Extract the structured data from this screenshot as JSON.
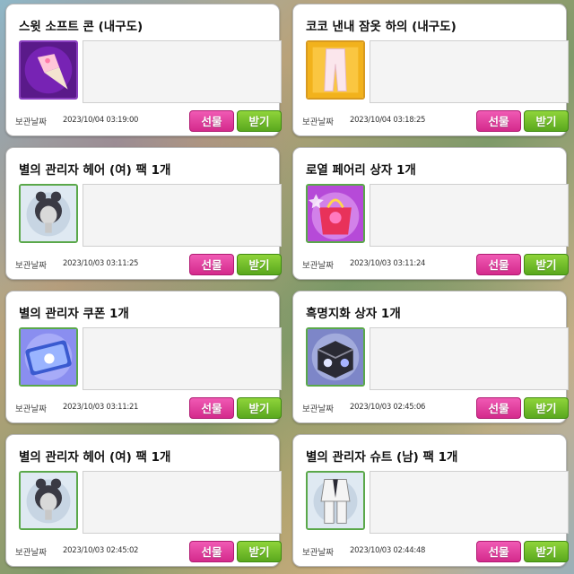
{
  "labels": {
    "date_label": "보관날짜",
    "gift_button": "선물",
    "receive_button": "받기"
  },
  "items": [
    {
      "name": "스윗 소프트 콘 (내구도)",
      "date": "2023/10/04 03:19:00",
      "icon": "soft-cone-icon"
    },
    {
      "name": "코코 낸내 잠옷 하의 (내구도)",
      "date": "2023/10/04 03:18:25",
      "icon": "pajama-pants-icon"
    },
    {
      "name": "별의 관리자 헤어 (여) 팩 1개",
      "date": "2023/10/03 03:11:25",
      "icon": "female-hair-icon"
    },
    {
      "name": "로열 페어리 상자 1개",
      "date": "2023/10/03 03:11:24",
      "icon": "fairy-box-icon"
    },
    {
      "name": "별의 관리자 쿠폰 1개",
      "date": "2023/10/03 03:11:21",
      "icon": "coupon-icon"
    },
    {
      "name": "흑명지화 상자 1개",
      "date": "2023/10/03 02:45:06",
      "icon": "dark-box-icon"
    },
    {
      "name": "별의 관리자 헤어 (여) 팩 1개",
      "date": "2023/10/03 02:45:02",
      "icon": "female-hair-icon"
    },
    {
      "name": "별의 관리자 슈트 (남) 팩 1개",
      "date": "2023/10/03 02:44:48",
      "icon": "male-suit-icon"
    }
  ]
}
